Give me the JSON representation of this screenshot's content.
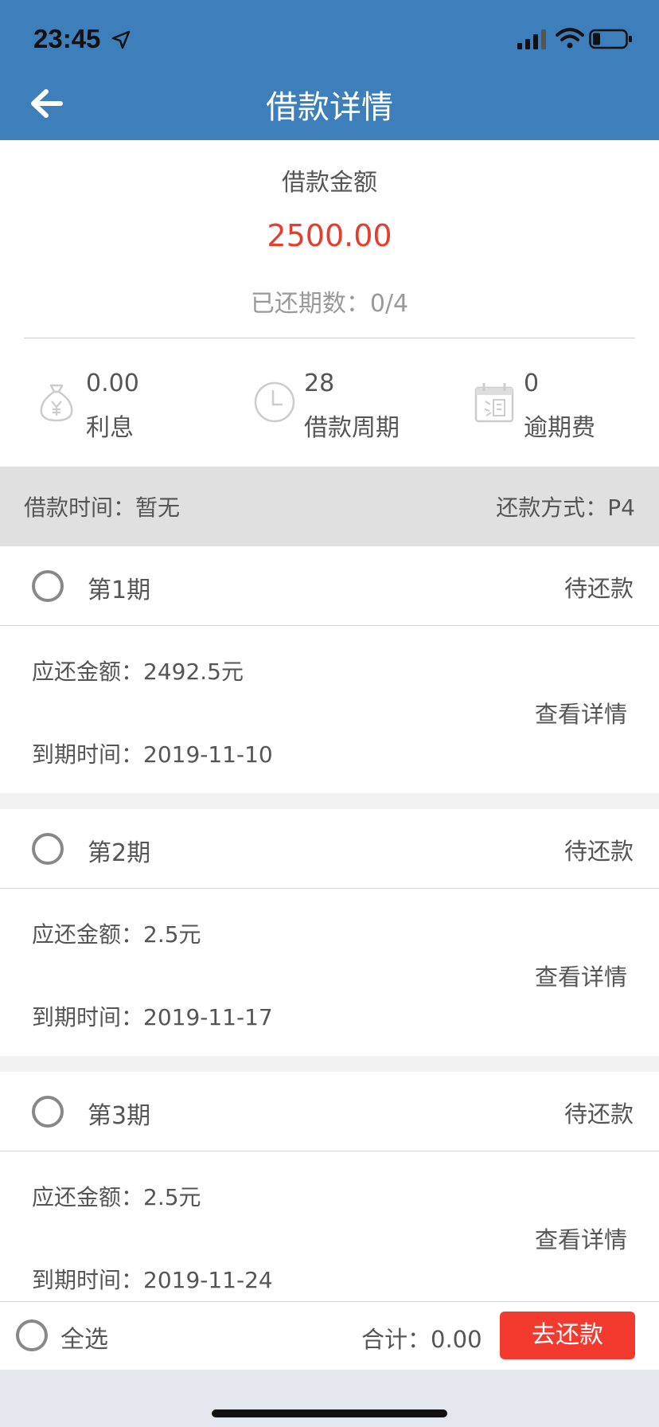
{
  "status_bar": {
    "time": "23:45"
  },
  "header": {
    "title": "借款详情"
  },
  "summary": {
    "amount_label": "借款金额",
    "amount_value": "2500.00",
    "progress_text": "已还期数：0/4"
  },
  "stats": [
    {
      "value": "0.00",
      "label": "利息",
      "icon": "money-bag-icon"
    },
    {
      "value": "28",
      "label": "借款周期",
      "icon": "clock-icon"
    },
    {
      "value": "0",
      "label": "逾期费",
      "icon": "calendar-overdue-icon"
    }
  ],
  "info_bar": {
    "loan_time": "借款时间：暂无",
    "repay_method": "还款方式：P4"
  },
  "periods": [
    {
      "name": "第1期",
      "state": "待还款",
      "due_amount": "应还金额：2492.5元",
      "due_date": "到期时间：2019-11-10",
      "detail_label": "查看详情"
    },
    {
      "name": "第2期",
      "state": "待还款",
      "due_amount": "应还金额：2.5元",
      "due_date": "到期时间：2019-11-17",
      "detail_label": "查看详情"
    },
    {
      "name": "第3期",
      "state": "待还款",
      "due_amount": "应还金额：2.5元",
      "due_date": "到期时间：2019-11-24",
      "detail_label": "查看详情"
    }
  ],
  "bottom_bar": {
    "select_all": "全选",
    "total": "合计：0.00",
    "pay_button": "去还款"
  },
  "colors": {
    "header_bg": "#3d7fbb",
    "amount_red": "#e63d2e",
    "pay_button_bg": "#f23a2e"
  }
}
